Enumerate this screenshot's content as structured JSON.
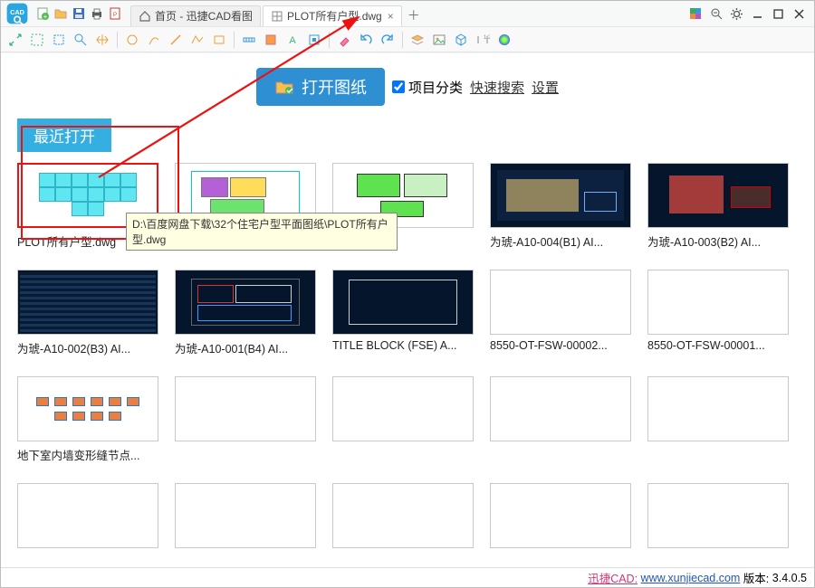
{
  "titlebar": {
    "tabs": [
      {
        "label": "首页 - 迅捷CAD看图",
        "active": false,
        "icon": "home"
      },
      {
        "label": "PLOT所有户型.dwg",
        "active": true,
        "icon": "grid",
        "closable": true
      }
    ]
  },
  "action": {
    "open_label": "打开图纸",
    "checkbox_label": "项目分类",
    "quick_search": "快速搜索",
    "settings": "设置"
  },
  "section": {
    "recent": "最近打开"
  },
  "tooltip": "D:\\百度网盘下载\\32个住宅户型平面图纸\\PLOT所有户型.dwg",
  "items": [
    {
      "label": "PLOT所有户型.dwg",
      "style": "blue",
      "dark": false,
      "hl": true
    },
    {
      "label": "",
      "style": "plan",
      "dark": false
    },
    {
      "label": "",
      "style": "green",
      "dark": false
    },
    {
      "label": "为琥-A10-004(B1) AI...",
      "style": "d1",
      "dark": true
    },
    {
      "label": "为琥-A10-003(B2) AI...",
      "style": "d2",
      "dark": true
    },
    {
      "label": "为琥-A10-002(B3) AI...",
      "style": "grid1",
      "dark": true
    },
    {
      "label": "为琥-A10-001(B4) AI...",
      "style": "redplan",
      "dark": true
    },
    {
      "label": "TITLE BLOCK (FSE) A...",
      "style": "frame",
      "dark": true
    },
    {
      "label": "8550-OT-FSW-00002...",
      "style": "empty",
      "dark": false
    },
    {
      "label": "8550-OT-FSW-00001...",
      "style": "empty",
      "dark": false
    },
    {
      "label": "地下室内墙变形缝节点...",
      "style": "icons2",
      "dark": false
    },
    {
      "label": "",
      "style": "empty",
      "dark": false
    },
    {
      "label": "",
      "style": "empty",
      "dark": false
    },
    {
      "label": "",
      "style": "empty",
      "dark": false
    },
    {
      "label": "",
      "style": "empty",
      "dark": false
    },
    {
      "label": "",
      "style": "empty",
      "dark": false
    },
    {
      "label": "",
      "style": "empty",
      "dark": false
    },
    {
      "label": "",
      "style": "empty",
      "dark": false
    },
    {
      "label": "",
      "style": "empty",
      "dark": false
    },
    {
      "label": "",
      "style": "empty",
      "dark": false
    }
  ],
  "status": {
    "brand": "迅捷CAD:",
    "url": "www.xunjiecad.com",
    "version_label": "版本:",
    "version": "3.4.0.5"
  }
}
